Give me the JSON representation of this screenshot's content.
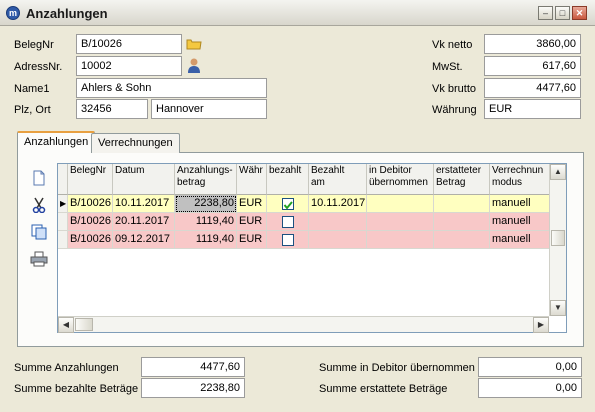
{
  "window": {
    "title": "Anzahlungen",
    "app_icon": "m"
  },
  "header": {
    "belegnr_label": "BelegNr",
    "belegnr_value": "B/10026",
    "adressnr_label": "AdressNr.",
    "adressnr_value": "10002",
    "name1_label": "Name1",
    "name1_value": "Ahlers & Sohn",
    "plz_label": "Plz, Ort",
    "plz_value": "32456",
    "ort_value": "Hannover",
    "vknetto_label": "Vk netto",
    "vknetto_value": "3860,00",
    "mwst_label": "MwSt.",
    "mwst_value": "617,60",
    "vkbrutto_label": "Vk brutto",
    "vkbrutto_value": "4477,60",
    "waehrung_label": "Währung",
    "waehrung_value": "EUR"
  },
  "tabs": [
    {
      "label": "Anzahlungen"
    },
    {
      "label": "Verrechnungen"
    }
  ],
  "table": {
    "columns": [
      "BelegNr",
      "Datum",
      "Anzahlungs-\nbetrag",
      "Währ",
      "bezahlt",
      "Bezahlt\nam",
      "in Debitor\nübernommen",
      "erstatteter\nBetrag",
      "Verrechnun\nmodus"
    ],
    "rows": [
      {
        "belegnr": "B/10026",
        "datum": "10.11.2017",
        "betrag": "2238,80",
        "waehrung": "EUR",
        "bezahlt": true,
        "bezahlt_am": "10.11.2017",
        "debitor": "",
        "erstattet": "",
        "modus": "manuell",
        "color": "#ffffc0"
      },
      {
        "belegnr": "B/10026",
        "datum": "20.11.2017",
        "betrag": "1119,40",
        "waehrung": "EUR",
        "bezahlt": false,
        "bezahlt_am": "",
        "debitor": "",
        "erstattet": "",
        "modus": "manuell",
        "color": "#f8c8c8"
      },
      {
        "belegnr": "B/10026",
        "datum": "09.12.2017",
        "betrag": "1119,40",
        "waehrung": "EUR",
        "bezahlt": false,
        "bezahlt_am": "",
        "debitor": "",
        "erstattet": "",
        "modus": "manuell",
        "color": "#f8c8c8"
      }
    ]
  },
  "side_tools": [
    "new-document-icon",
    "scissors-icon",
    "copy-icon",
    "printer-icon"
  ],
  "summary": {
    "anzahlungen_label": "Summe Anzahlungen",
    "anzahlungen_value": "4477,60",
    "bezahlte_label": "Summe bezahlte Beträge",
    "bezahlte_value": "2238,80",
    "debitor_label": "Summe in Debitor übernommen",
    "debitor_value": "0,00",
    "erstattete_label": "Summe erstattete Beträge",
    "erstattete_value": "0,00"
  }
}
